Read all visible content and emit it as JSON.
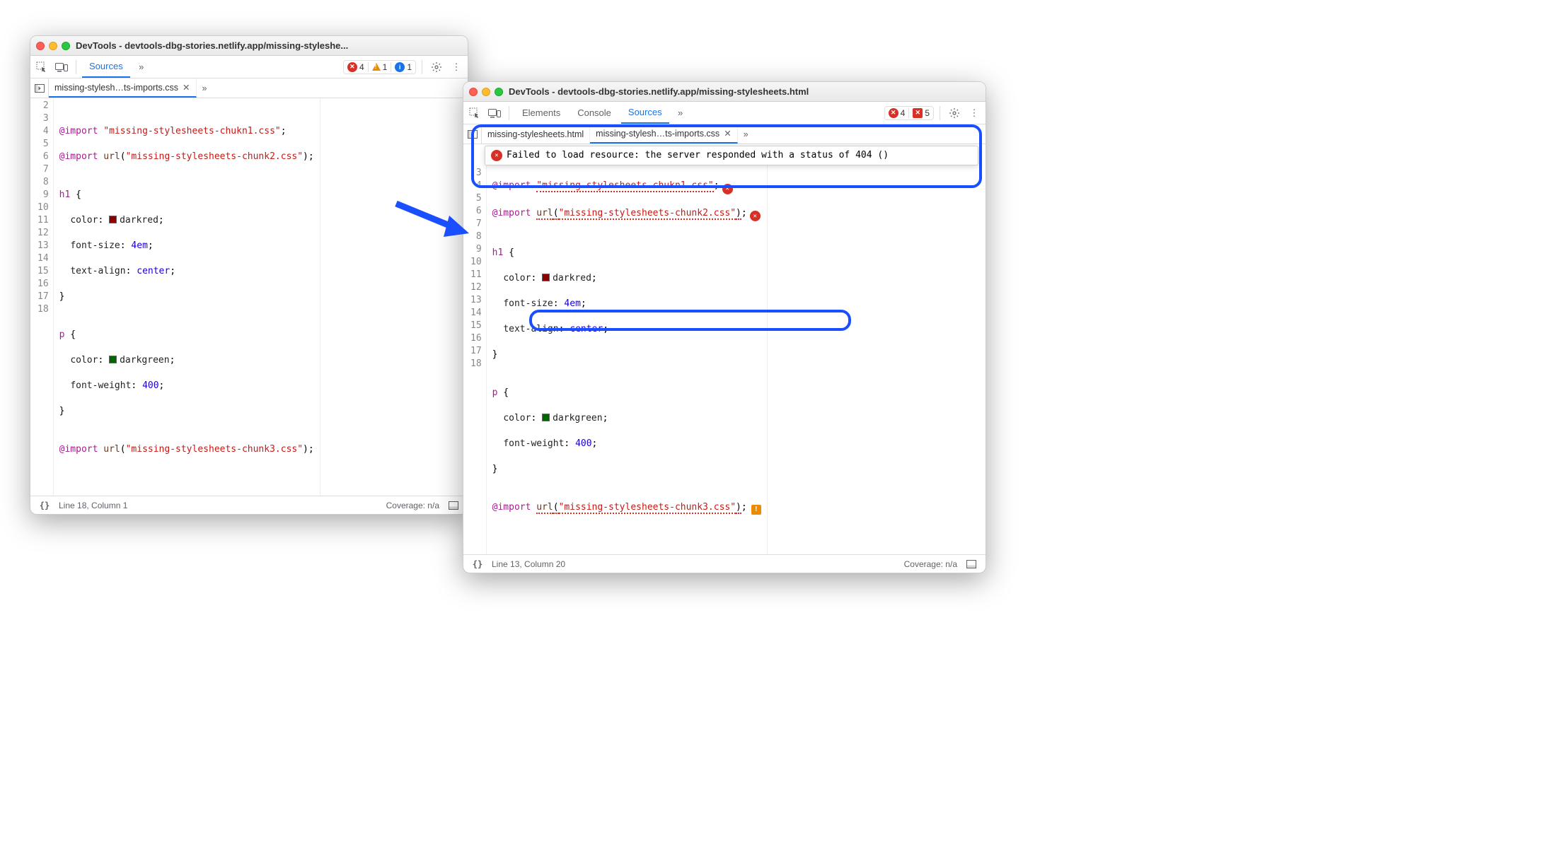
{
  "left": {
    "title": "DevTools - devtools-dbg-stories.netlify.app/missing-styleshe...",
    "tabs": {
      "sources": "Sources"
    },
    "counts": {
      "errors": "4",
      "warnings": "1",
      "info": "1"
    },
    "file_tab": "missing-stylesh…ts-imports.css",
    "status": {
      "pos": "Line 18, Column 1",
      "coverage": "Coverage: n/a"
    },
    "lines": [
      "2",
      "3",
      "4",
      "5",
      "6",
      "7",
      "8",
      "9",
      "10",
      "11",
      "12",
      "13",
      "14",
      "15",
      "16",
      "17",
      "18"
    ],
    "css": {
      "l3": {
        "at": "@import",
        "s1": "\"missing-stylesheets-chukn1.css\"",
        "sc": ";"
      },
      "l4": {
        "at": "@import",
        "fn": "url",
        "s2": "\"missing-stylesheets-chunk2.css\"",
        "sc": ";"
      },
      "l6": {
        "sel": "h1",
        "ob": " {"
      },
      "l7": {
        "p": "color",
        "c": ": ",
        "v": "darkred",
        "sc": ";"
      },
      "l8": {
        "p": "font-size",
        "c": ": ",
        "v": "4em",
        "sc": ";"
      },
      "l9": {
        "p": "text-align",
        "c": ": ",
        "v": "center",
        "sc": ";"
      },
      "l10": "}",
      "l12": {
        "sel": "p",
        "ob": " {"
      },
      "l13": {
        "p": "color",
        "c": ": ",
        "v": "darkgreen",
        "sc": ";"
      },
      "l14": {
        "p": "font-weight",
        "c": ": ",
        "v": "400",
        "sc": ";"
      },
      "l15": "}",
      "l17": {
        "at": "@import",
        "fn": "url",
        "s3": "\"missing-stylesheets-chunk3.css\"",
        "sc": ";"
      }
    }
  },
  "right": {
    "title": "DevTools - devtools-dbg-stories.netlify.app/missing-stylesheets.html",
    "tabs": {
      "elements": "Elements",
      "console": "Console",
      "sources": "Sources"
    },
    "counts": {
      "errors": "4",
      "issues": "5"
    },
    "file_tabs": {
      "html": "missing-stylesheets.html",
      "css": "missing-stylesh…ts-imports.css"
    },
    "tooltip": "Failed to load resource: the server responded with a status of 404 ()",
    "status": {
      "pos": "Line 13, Column 20",
      "coverage": "Coverage: n/a"
    },
    "lines": [
      "3",
      "4",
      "5",
      "6",
      "7",
      "8",
      "9",
      "10",
      "11",
      "12",
      "13",
      "14",
      "15",
      "16",
      "17",
      "18"
    ],
    "css": {
      "l3": {
        "at": "@import",
        "s1": "\"missing-stylesheets-chukn1.css\"",
        "sc": ";"
      },
      "l4": {
        "at": "@import",
        "fn": "url",
        "s2": "\"missing-stylesheets-chunk2.css\"",
        "sc": ";"
      },
      "l6": {
        "sel": "h1",
        "ob": " {"
      },
      "l7": {
        "p": "color",
        "c": ": ",
        "v": "darkred",
        "sc": ";"
      },
      "l8": {
        "p": "font-size",
        "c": ": ",
        "v": "4em",
        "sc": ";"
      },
      "l9": {
        "p": "text-align",
        "c": ": ",
        "v": "center",
        "sc": ";"
      },
      "l10": "}",
      "l12": {
        "sel": "p",
        "ob": " {"
      },
      "l13": {
        "p": "color",
        "c": ": ",
        "v": "darkgreen",
        "sc": ";"
      },
      "l14": {
        "p": "font-weight",
        "c": ": ",
        "v": "400",
        "sc": ";"
      },
      "l15": "}",
      "l17": {
        "at": "@import",
        "fn": "url",
        "s3": "\"missing-stylesheets-chunk3.css\"",
        "sc": ";"
      }
    }
  }
}
